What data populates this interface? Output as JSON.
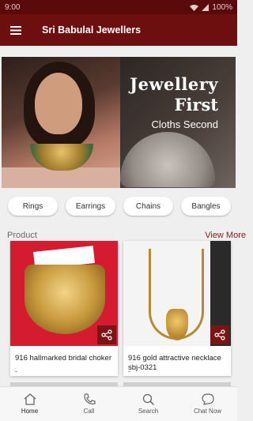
{
  "status": {
    "time": "9:00",
    "battery": "100%"
  },
  "appbar": {
    "title": "Sri Babulal Jewellers"
  },
  "banner": {
    "line1": "Jewellery",
    "line2": "First",
    "line3": "Cloths Second"
  },
  "categories": [
    "Rings",
    "Earrings",
    "Chains",
    "Bangles"
  ],
  "section": {
    "title": "Product",
    "view_more": "View More"
  },
  "products": [
    {
      "name": "916 hallmarked bridal choker",
      "sub": "-"
    },
    {
      "name": "916 gold attractive necklace sbj-0321",
      "sub": "-"
    }
  ],
  "bottom_nav": [
    {
      "label": "Home",
      "icon": "home-icon"
    },
    {
      "label": "Call",
      "icon": "phone-icon"
    },
    {
      "label": "Search",
      "icon": "search-icon"
    },
    {
      "label": "Chat Now",
      "icon": "chat-icon"
    }
  ],
  "colors": {
    "primary": "#6d0f0f",
    "accent": "#8b1a1a"
  }
}
